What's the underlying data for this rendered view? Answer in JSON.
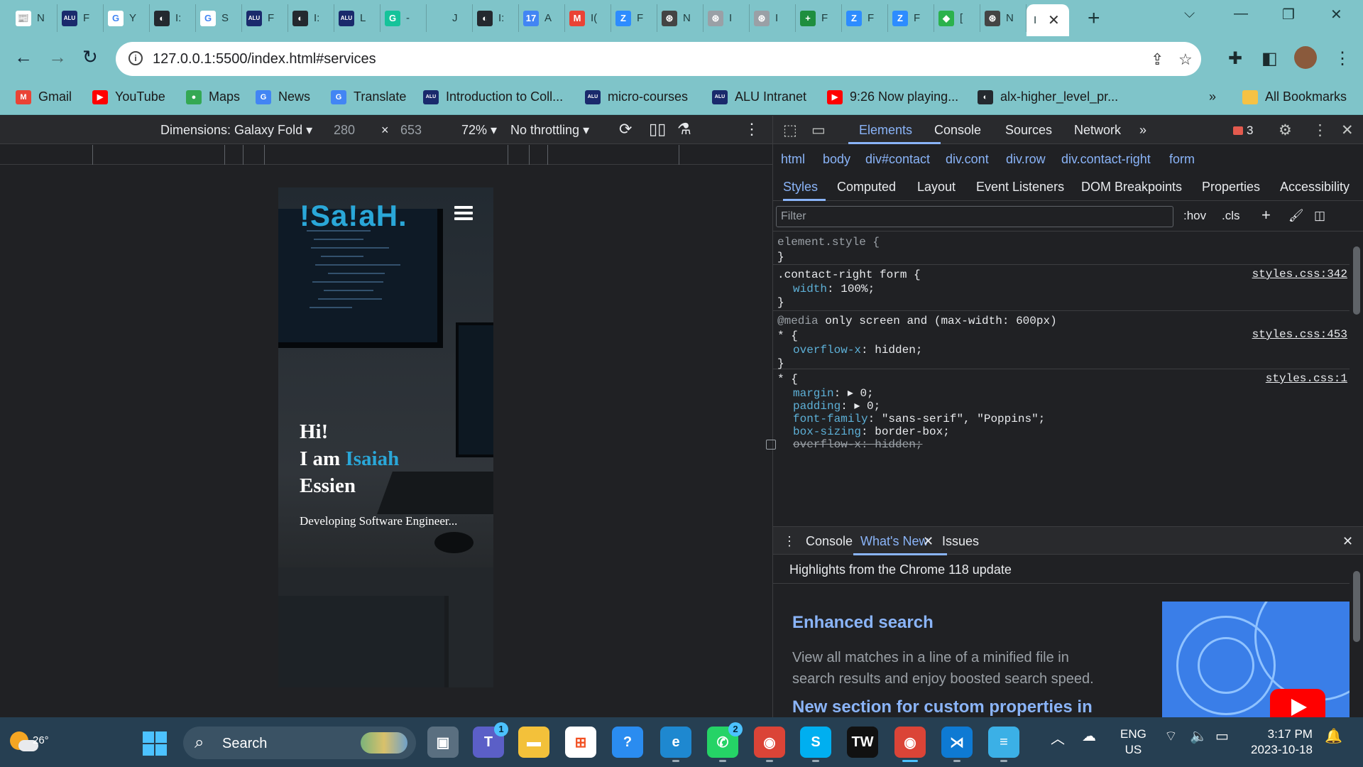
{
  "browser": {
    "tabs": [
      {
        "icon": "news-icon",
        "color": "#ffffff",
        "glyph": "📰",
        "text": "N"
      },
      {
        "icon": "alu-icon",
        "color": "#1a2a6c",
        "glyph": "ALU",
        "text": "F"
      },
      {
        "icon": "google-icon",
        "color": "#ffffff",
        "glyph": "G",
        "text": "Y"
      },
      {
        "icon": "github-icon",
        "color": "#24292f",
        "glyph": "◐",
        "text": "I:"
      },
      {
        "icon": "google-icon",
        "color": "#ffffff",
        "glyph": "G",
        "text": "S"
      },
      {
        "icon": "alu-icon",
        "color": "#1a2a6c",
        "glyph": "ALU",
        "text": "F"
      },
      {
        "icon": "github-icon",
        "color": "#24292f",
        "glyph": "◐",
        "text": "I:"
      },
      {
        "icon": "alu-icon",
        "color": "#1a2a6c",
        "glyph": "ALU",
        "text": "L"
      },
      {
        "icon": "grammarly-icon",
        "color": "#15c39a",
        "glyph": "G",
        "text": "-"
      },
      {
        "icon": "blank-icon",
        "color": "#7fc4c9",
        "glyph": "",
        "text": "J"
      },
      {
        "icon": "github-icon",
        "color": "#24292f",
        "glyph": "◐",
        "text": "I:"
      },
      {
        "icon": "calendar-icon",
        "color": "#4285f4",
        "glyph": "17",
        "text": "A"
      },
      {
        "icon": "gmail-icon",
        "color": "#ea4335",
        "glyph": "M",
        "text": "I("
      },
      {
        "icon": "zoom-icon",
        "color": "#2d8cff",
        "glyph": "Z",
        "text": "F"
      },
      {
        "icon": "chatgpt-icon",
        "color": "#444444",
        "glyph": "⊛",
        "text": "N"
      },
      {
        "icon": "chatgpt-icon",
        "color": "#9aa0a6",
        "glyph": "⊛",
        "text": "I"
      },
      {
        "icon": "chatgpt-icon",
        "color": "#9aa0a6",
        "glyph": "⊛",
        "text": "I"
      },
      {
        "icon": "plus-green-icon",
        "color": "#1e8e3e",
        "glyph": "+",
        "text": "F"
      },
      {
        "icon": "zoom-icon",
        "color": "#2d8cff",
        "glyph": "Z",
        "text": "F"
      },
      {
        "icon": "zoom-icon",
        "color": "#2d8cff",
        "glyph": "Z",
        "text": "F"
      },
      {
        "icon": "feedly-icon",
        "color": "#2bb24c",
        "glyph": "◆",
        "text": "["
      },
      {
        "icon": "chatgpt-icon",
        "color": "#444444",
        "glyph": "⊛",
        "text": "N"
      }
    ],
    "active_tab_text": "I",
    "url": "127.0.0.1:5500/index.html#services",
    "bookmarks": [
      {
        "label": "Gmail",
        "icon": "gmail-icon",
        "color": "#ea4335",
        "glyph": "M"
      },
      {
        "label": "YouTube",
        "icon": "youtube-icon",
        "color": "#ff0000",
        "glyph": "▶"
      },
      {
        "label": "Maps",
        "icon": "maps-icon",
        "color": "#34a853",
        "glyph": "●"
      },
      {
        "label": "News",
        "icon": "news-icon",
        "color": "#4285f4",
        "glyph": "G"
      },
      {
        "label": "Translate",
        "icon": "translate-icon",
        "color": "#4285f4",
        "glyph": "G"
      },
      {
        "label": "Introduction to Coll...",
        "icon": "alu-icon",
        "color": "#1a2a6c",
        "glyph": "ALU"
      },
      {
        "label": "micro-courses",
        "icon": "alu-icon",
        "color": "#1a2a6c",
        "glyph": "ALU"
      },
      {
        "label": "ALU Intranet",
        "icon": "alu-icon",
        "color": "#1a2a6c",
        "glyph": "ALU"
      },
      {
        "label": "9:26 Now playing...",
        "icon": "youtube-icon",
        "color": "#ff0000",
        "glyph": "▶"
      },
      {
        "label": "alx-higher_level_pr...",
        "icon": "github-icon",
        "color": "#24292f",
        "glyph": "◐"
      }
    ],
    "overflow_label": "»",
    "all_bookmarks": "All Bookmarks"
  },
  "device_toolbar": {
    "dimensions_label": "Dimensions: Galaxy Fold",
    "width": "280",
    "times": "×",
    "height": "653",
    "zoom": "72%",
    "throttling": "No throttling"
  },
  "page_preview": {
    "brand": "!Sa!aH.",
    "greeting": "Hi!",
    "intro_prefix": "I am",
    "first_name": "Isaiah",
    "last_name": "Essien",
    "tagline": "Developing Software Engineer..."
  },
  "devtools": {
    "tabs": [
      "Elements",
      "Console",
      "Sources",
      "Network"
    ],
    "more": "»",
    "error_count": "3",
    "breadcrumbs": [
      "html",
      "body",
      "div#contact",
      "div.cont",
      "div.row",
      "div.contact-right",
      "form"
    ],
    "subtabs": [
      "Styles",
      "Computed",
      "Layout",
      "Event Listeners",
      "DOM Breakpoints",
      "Properties",
      "Accessibility"
    ],
    "filter_placeholder": "Filter",
    "hov": ":hov",
    ".cls": ".cls",
    "rules": {
      "r1_selector": "element.style {",
      "close": "}",
      "r2_selector": ".contact-right form {",
      "r2_source": "styles.css:342",
      "r2_prop": "width",
      "r2_val": "100%;",
      "r3_media_kw": "@media",
      "r3_media": "only screen and (max-width: 600px)",
      "r3_selector": "* {",
      "r3_source": "styles.css:453",
      "r3_prop": "overflow-x",
      "r3_val": "hidden;",
      "r4_selector": "* {",
      "r4_source": "styles.css:1",
      "r4_decls": [
        {
          "prop": "margin",
          "val": "▸ 0;"
        },
        {
          "prop": "padding",
          "val": "▸ 0;"
        },
        {
          "prop": "font-family",
          "val": "\"sans-serif\", \"Poppins\";"
        },
        {
          "prop": "box-sizing",
          "val": "border-box;"
        }
      ],
      "r4_struck": "overflow-x: hidden;"
    },
    "drawer_tabs": [
      "Console",
      "What's New",
      "Issues"
    ],
    "whatsnew": {
      "highlights": "Highlights from the Chrome 118 update",
      "h1": "Enhanced search",
      "p1": "View all matches in a line of a minified file in search results and enjoy boosted search speed.",
      "h2": "New section for custom properties in"
    }
  },
  "taskbar": {
    "temperature": "26°",
    "search_label": "Search",
    "apps": [
      {
        "name": "task-view-icon",
        "color": "#5a6f80",
        "glyph": "▣",
        "badge": ""
      },
      {
        "name": "teams-icon",
        "color": "#5b5fc7",
        "glyph": "T",
        "badge": "1"
      },
      {
        "name": "file-explorer-icon",
        "color": "#f3c13a",
        "glyph": "▬",
        "badge": ""
      },
      {
        "name": "microsoft-store-icon",
        "color": "#ffffff",
        "glyph": "⊞",
        "badge": ""
      },
      {
        "name": "help-icon",
        "color": "#2a8cf0",
        "glyph": "?",
        "badge": ""
      },
      {
        "name": "edge-icon",
        "color": "#1e88d0",
        "glyph": "e",
        "badge": ""
      },
      {
        "name": "whatsapp-icon",
        "color": "#25d366",
        "glyph": "✆",
        "badge": "2"
      },
      {
        "name": "chrome-icon",
        "color": "#db4437",
        "glyph": "◉",
        "badge": ""
      },
      {
        "name": "skype-icon",
        "color": "#00aff0",
        "glyph": "S",
        "badge": ""
      },
      {
        "name": "terminal-icon",
        "color": "#111111",
        "glyph": "TW",
        "badge": ""
      },
      {
        "name": "chrome-profile-icon",
        "color": "#db4437",
        "glyph": "◉",
        "badge": ""
      },
      {
        "name": "vscode-icon",
        "color": "#0e7ad3",
        "glyph": "⋊",
        "badge": ""
      },
      {
        "name": "notepad-icon",
        "color": "#3bb0e6",
        "glyph": "≡",
        "badge": ""
      }
    ],
    "lang_top": "ENG",
    "lang_bottom": "US",
    "time": "3:17 PM",
    "date": "2023-10-18"
  }
}
